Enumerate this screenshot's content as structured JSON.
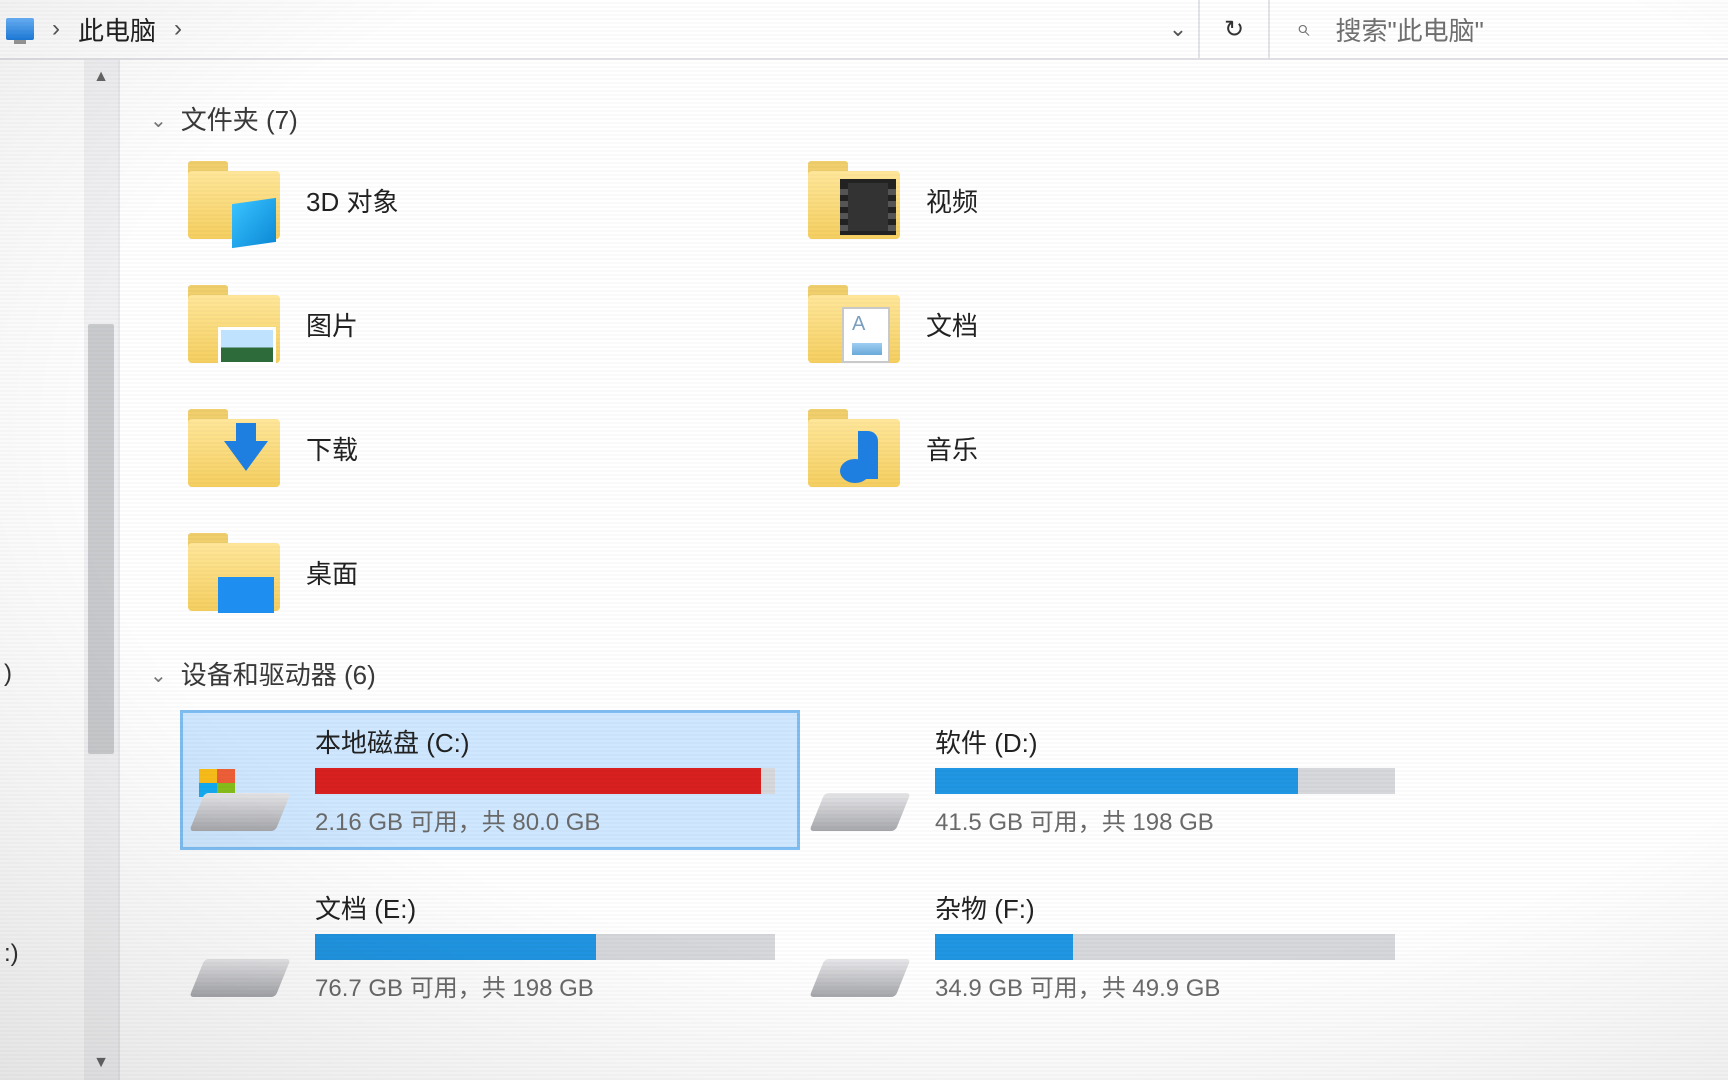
{
  "breadcrumb": {
    "location": "此电脑",
    "sep": "›"
  },
  "toolbar": {
    "refresh_glyph": "↻",
    "dropdown_glyph": "⌄"
  },
  "search": {
    "icon": "⌕",
    "placeholder": "搜索\"此电脑\""
  },
  "sidebar": {
    "hint1": ")",
    "hint2": ":)"
  },
  "scroll": {
    "up": "▲",
    "down": "▼"
  },
  "groups": {
    "folders": {
      "chevron": "⌄",
      "label": "文件夹 (7)"
    },
    "drives": {
      "chevron": "⌄",
      "label": "设备和驱动器 (6)"
    }
  },
  "folders": [
    {
      "name": "3D 对象",
      "kind": "3d"
    },
    {
      "name": "视频",
      "kind": "video"
    },
    {
      "name": "图片",
      "kind": "pictures"
    },
    {
      "name": "文档",
      "kind": "documents"
    },
    {
      "name": "下载",
      "kind": "downloads"
    },
    {
      "name": "音乐",
      "kind": "music"
    },
    {
      "name": "桌面",
      "kind": "desktop"
    }
  ],
  "drives": [
    {
      "name": "本地磁盘 (C:)",
      "status": "2.16 GB 可用，共 80.0 GB",
      "fill_pct": 97,
      "critical": true,
      "system_drive": true,
      "selected": true
    },
    {
      "name": "软件 (D:)",
      "status": "41.5 GB 可用，共 198 GB",
      "fill_pct": 79,
      "critical": false,
      "system_drive": false,
      "selected": false
    },
    {
      "name": "文档 (E:)",
      "status": "76.7 GB 可用，共 198 GB",
      "fill_pct": 61,
      "critical": false,
      "system_drive": false,
      "selected": false
    },
    {
      "name": "杂物 (F:)",
      "status": "34.9 GB 可用，共 49.9 GB",
      "fill_pct": 30,
      "critical": false,
      "system_drive": false,
      "selected": false
    }
  ]
}
